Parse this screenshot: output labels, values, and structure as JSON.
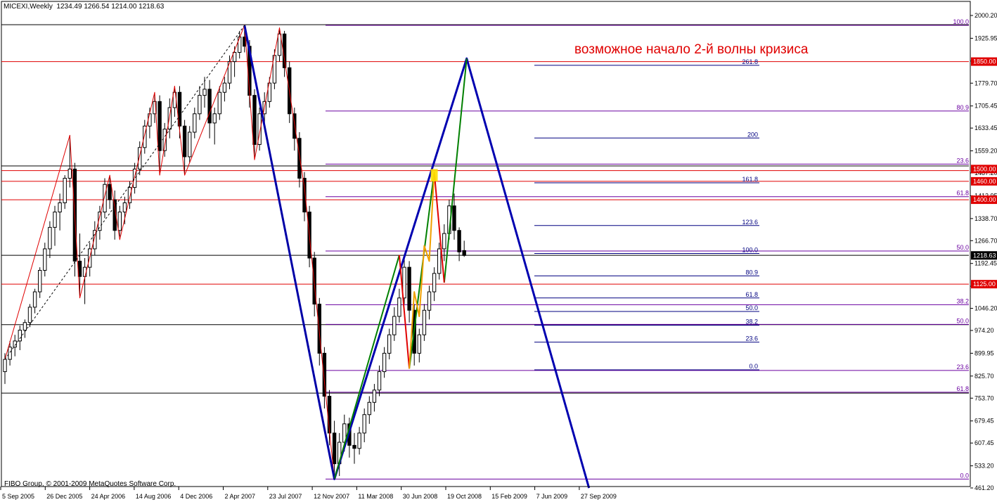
{
  "window": {
    "title": "MICEXI,Weekly",
    "ohlc": "1234.49 1266.54 1214.00 1218.63",
    "copyright": "FIBO Group, © 2001-2009 MetaQuotes Software Corp."
  },
  "annotation": "возможное начало 2-й волны кризиса",
  "colors": {
    "candle": "#000000",
    "blue_wave": "#0000b0",
    "green_wave": "#008000",
    "red_wave": "#e00000",
    "orange_wave": "#f0a000",
    "zigzag": "#c00000",
    "hline_black": "#000000",
    "hline_red": "#e00000",
    "fib_purple": "#6a00a0",
    "fib_blue": "#000080",
    "highlight": "#ffe000"
  },
  "chart_data": {
    "type": "candlestick",
    "symbol": "MICEXI",
    "timeframe": "Weekly",
    "ylim": [
      461.2,
      2030
    ],
    "y_ticks": [
      "2000.20",
      "1925.95",
      "1851.70",
      "1779.70",
      "1705.45",
      "1633.45",
      "1559.20",
      "1487.20",
      "1412.95",
      "1338.70",
      "1266.70",
      "1192.45",
      "1118.20",
      "1046.20",
      "974.20",
      "899.95",
      "825.70",
      "753.70",
      "679.45",
      "607.45",
      "533.20",
      "461.20"
    ],
    "x_ticks": [
      "5 Sep 2005",
      "26 Dec 2005",
      "24 Apr 2006",
      "14 Aug 2006",
      "4 Dec 2006",
      "2 Apr 2007",
      "23 Jul 2007",
      "12 Nov 2007",
      "11 Mar 2008",
      "30 Jun 2008",
      "19 Oct 2008",
      "15 Feb 2009",
      "7 Jun 2009",
      "27 Sep 2009"
    ],
    "price_labels": [
      {
        "value": 1850.0,
        "text": "1850.00",
        "color": "red"
      },
      {
        "value": 1500.0,
        "text": "1500.00",
        "color": "red"
      },
      {
        "value": 1460.0,
        "text": "1460.00",
        "color": "red"
      },
      {
        "value": 1400.0,
        "text": "1400.00",
        "color": "red"
      },
      {
        "value": 1218.63,
        "text": "1218.63",
        "color": "black"
      },
      {
        "value": 1125.0,
        "text": "1125.00",
        "color": "red"
      }
    ],
    "horizontal_levels": [
      {
        "price": 1970,
        "color": "black"
      },
      {
        "price": 1850,
        "color": "red"
      },
      {
        "price": 1510,
        "color": "black"
      },
      {
        "price": 1495,
        "color": "red"
      },
      {
        "price": 1460,
        "color": "red"
      },
      {
        "price": 1400,
        "color": "red"
      },
      {
        "price": 1219,
        "color": "black"
      },
      {
        "price": 1125,
        "color": "red"
      },
      {
        "price": 993,
        "color": "black"
      },
      {
        "price": 770,
        "color": "black"
      }
    ],
    "fib_sets": [
      {
        "name": "fib_large",
        "color": "purple",
        "levels": [
          {
            "label": "100.0",
            "price": 1968
          },
          {
            "label": "80.9",
            "price": 1689
          },
          {
            "label": "23.6",
            "price": 1516
          },
          {
            "label": "61.8",
            "price": 1410
          },
          {
            "label": "50.0",
            "price": 1233
          },
          {
            "label": "38.2",
            "price": 1058
          },
          {
            "label": "50.0",
            "price": 994
          },
          {
            "label": "23.6",
            "price": 844
          },
          {
            "label": "61.8",
            "price": 773
          },
          {
            "label": "0.0",
            "price": 490
          }
        ]
      },
      {
        "name": "fib_projection",
        "color": "navy",
        "levels": [
          {
            "label": "261.8",
            "price": 1838
          },
          {
            "label": "200",
            "price": 1601
          },
          {
            "label": "161.8",
            "price": 1455
          },
          {
            "label": "123.6",
            "price": 1316
          },
          {
            "label": "100.0",
            "price": 1225
          },
          {
            "label": "80.9",
            "price": 1152
          },
          {
            "label": "61.8",
            "price": 1080
          },
          {
            "label": "50.0",
            "price": 1036
          },
          {
            "label": "38.2",
            "price": 991
          },
          {
            "label": "23.6",
            "price": 936
          },
          {
            "label": "0.0",
            "price": 846
          }
        ]
      }
    ],
    "candles": [
      [
        840,
        900,
        800,
        880
      ],
      [
        880,
        940,
        860,
        920
      ],
      [
        920,
        960,
        890,
        940
      ],
      [
        940,
        990,
        910,
        975
      ],
      [
        975,
        1010,
        950,
        1000
      ],
      [
        1000,
        1060,
        985,
        1050
      ],
      [
        1050,
        1110,
        1030,
        1100
      ],
      [
        1100,
        1180,
        1080,
        1170
      ],
      [
        1170,
        1260,
        1150,
        1240
      ],
      [
        1240,
        1330,
        1210,
        1310
      ],
      [
        1310,
        1380,
        1250,
        1360
      ],
      [
        1360,
        1420,
        1300,
        1390
      ],
      [
        1390,
        1480,
        1370,
        1470
      ],
      [
        1470,
        1610,
        1440,
        1500
      ],
      [
        1500,
        1520,
        1150,
        1200
      ],
      [
        1200,
        1290,
        1080,
        1150
      ],
      [
        1150,
        1210,
        1060,
        1180
      ],
      [
        1180,
        1260,
        1150,
        1240
      ],
      [
        1240,
        1330,
        1220,
        1300
      ],
      [
        1300,
        1380,
        1270,
        1360
      ],
      [
        1360,
        1470,
        1340,
        1450
      ],
      [
        1450,
        1480,
        1370,
        1400
      ],
      [
        1400,
        1430,
        1270,
        1300
      ],
      [
        1300,
        1380,
        1280,
        1360
      ],
      [
        1360,
        1410,
        1320,
        1390
      ],
      [
        1390,
        1460,
        1370,
        1440
      ],
      [
        1440,
        1520,
        1420,
        1500
      ],
      [
        1500,
        1590,
        1480,
        1570
      ],
      [
        1570,
        1660,
        1550,
        1640
      ],
      [
        1640,
        1700,
        1600,
        1680
      ],
      [
        1680,
        1750,
        1650,
        1720
      ],
      [
        1720,
        1740,
        1480,
        1560
      ],
      [
        1560,
        1650,
        1540,
        1630
      ],
      [
        1630,
        1730,
        1600,
        1700
      ],
      [
        1700,
        1770,
        1670,
        1750
      ],
      [
        1750,
        1770,
        1600,
        1640
      ],
      [
        1640,
        1660,
        1480,
        1540
      ],
      [
        1540,
        1640,
        1520,
        1620
      ],
      [
        1620,
        1700,
        1600,
        1680
      ],
      [
        1680,
        1770,
        1660,
        1740
      ],
      [
        1740,
        1800,
        1700,
        1760
      ],
      [
        1760,
        1790,
        1600,
        1650
      ],
      [
        1650,
        1700,
        1580,
        1680
      ],
      [
        1680,
        1770,
        1660,
        1750
      ],
      [
        1750,
        1800,
        1720,
        1780
      ],
      [
        1780,
        1870,
        1760,
        1850
      ],
      [
        1850,
        1900,
        1800,
        1880
      ],
      [
        1880,
        1950,
        1860,
        1930
      ],
      [
        1930,
        1968,
        1880,
        1900
      ],
      [
        1900,
        1920,
        1700,
        1740
      ],
      [
        1740,
        1760,
        1530,
        1580
      ],
      [
        1580,
        1700,
        1560,
        1680
      ],
      [
        1680,
        1750,
        1640,
        1720
      ],
      [
        1720,
        1800,
        1700,
        1780
      ],
      [
        1780,
        1890,
        1760,
        1870
      ],
      [
        1870,
        1960,
        1850,
        1940
      ],
      [
        1940,
        1950,
        1800,
        1830
      ],
      [
        1830,
        1850,
        1650,
        1680
      ],
      [
        1680,
        1700,
        1560,
        1600
      ],
      [
        1600,
        1620,
        1440,
        1470
      ],
      [
        1470,
        1490,
        1330,
        1360
      ],
      [
        1360,
        1380,
        1180,
        1210
      ],
      [
        1210,
        1230,
        1020,
        1060
      ],
      [
        1060,
        1080,
        860,
        900
      ],
      [
        900,
        920,
        720,
        760
      ],
      [
        760,
        780,
        600,
        640
      ],
      [
        640,
        680,
        490,
        540
      ],
      [
        540,
        640,
        500,
        610
      ],
      [
        610,
        700,
        580,
        670
      ],
      [
        670,
        690,
        560,
        600
      ],
      [
        600,
        640,
        540,
        590
      ],
      [
        590,
        660,
        570,
        640
      ],
      [
        640,
        720,
        610,
        700
      ],
      [
        700,
        760,
        670,
        740
      ],
      [
        740,
        800,
        710,
        780
      ],
      [
        780,
        860,
        760,
        840
      ],
      [
        840,
        920,
        820,
        900
      ],
      [
        900,
        980,
        880,
        960
      ],
      [
        960,
        1050,
        940,
        1020
      ],
      [
        1020,
        1110,
        1000,
        1080
      ],
      [
        1080,
        1220,
        1060,
        1180
      ],
      [
        1180,
        1200,
        1000,
        1040
      ],
      [
        1040,
        1060,
        860,
        900
      ],
      [
        900,
        980,
        870,
        960
      ],
      [
        960,
        1060,
        940,
        1040
      ],
      [
        1040,
        1120,
        1010,
        1100
      ],
      [
        1100,
        1180,
        1070,
        1160
      ],
      [
        1160,
        1260,
        1140,
        1240
      ],
      [
        1240,
        1320,
        1200,
        1290
      ],
      [
        1290,
        1400,
        1270,
        1380
      ],
      [
        1380,
        1420,
        1270,
        1300
      ],
      [
        1300,
        1310,
        1200,
        1230
      ],
      [
        1234.49,
        1266.54,
        1214,
        1218.63
      ]
    ],
    "waves": [
      {
        "name": "zigzag",
        "color": "red",
        "width": 1,
        "points": [
          [
            0,
            880
          ],
          [
            13,
            1610
          ],
          [
            15,
            1080
          ],
          [
            21,
            1480
          ],
          [
            23,
            1270
          ],
          [
            30,
            1750
          ],
          [
            31,
            1480
          ],
          [
            34,
            1770
          ],
          [
            36,
            1480
          ],
          [
            48,
            1968
          ],
          [
            50,
            1530
          ],
          [
            55,
            1960
          ],
          [
            60,
            1440
          ],
          [
            66,
            490
          ]
        ]
      },
      {
        "name": "blue-wave",
        "color": "blue",
        "width": 3,
        "points": [
          [
            48,
            1968
          ],
          [
            66,
            490
          ],
          [
            92.5,
            1860
          ],
          [
            117,
            461
          ]
        ]
      },
      {
        "name": "blue-channel",
        "color": "blue",
        "width": 2,
        "points": [
          [
            66,
            490
          ],
          [
            92.5,
            1860
          ]
        ]
      },
      {
        "name": "green-impulse-1",
        "color": "green",
        "width": 2,
        "points": [
          [
            66,
            490
          ],
          [
            79,
            1220
          ]
        ]
      },
      {
        "name": "green-impulse-2",
        "color": "green",
        "width": 2,
        "points": [
          [
            81,
            850
          ],
          [
            86,
            1490
          ]
        ]
      },
      {
        "name": "green-impulse-3",
        "color": "green",
        "width": 2,
        "points": [
          [
            88,
            1130
          ],
          [
            92.5,
            1860
          ]
        ]
      },
      {
        "name": "red-correction-1",
        "color": "red",
        "width": 2,
        "points": [
          [
            79,
            1220
          ],
          [
            81,
            850
          ]
        ]
      },
      {
        "name": "red-correction-2",
        "color": "red",
        "width": 2,
        "points": [
          [
            86,
            1490
          ],
          [
            88,
            1130
          ]
        ]
      },
      {
        "name": "orange-sub",
        "color": "orange",
        "width": 2,
        "points": [
          [
            81,
            850
          ],
          [
            82,
            1100
          ],
          [
            83,
            1020
          ],
          [
            84,
            1250
          ],
          [
            85,
            1200
          ],
          [
            86,
            1490
          ]
        ]
      },
      {
        "name": "dashed-trend",
        "color": "black",
        "width": 1,
        "dashed": true,
        "points": [
          [
            0,
            880
          ],
          [
            48,
            1968
          ]
        ]
      },
      {
        "name": "dashed-fall",
        "color": "navy",
        "width": 1,
        "dashed": true,
        "points": [
          [
            52,
            1640
          ],
          [
            66,
            490
          ]
        ]
      }
    ],
    "highlight_box": {
      "price_low": 1460,
      "price_high": 1500,
      "x_from": 85.3,
      "x_to": 86.7
    },
    "grid": false,
    "legend": "none"
  }
}
